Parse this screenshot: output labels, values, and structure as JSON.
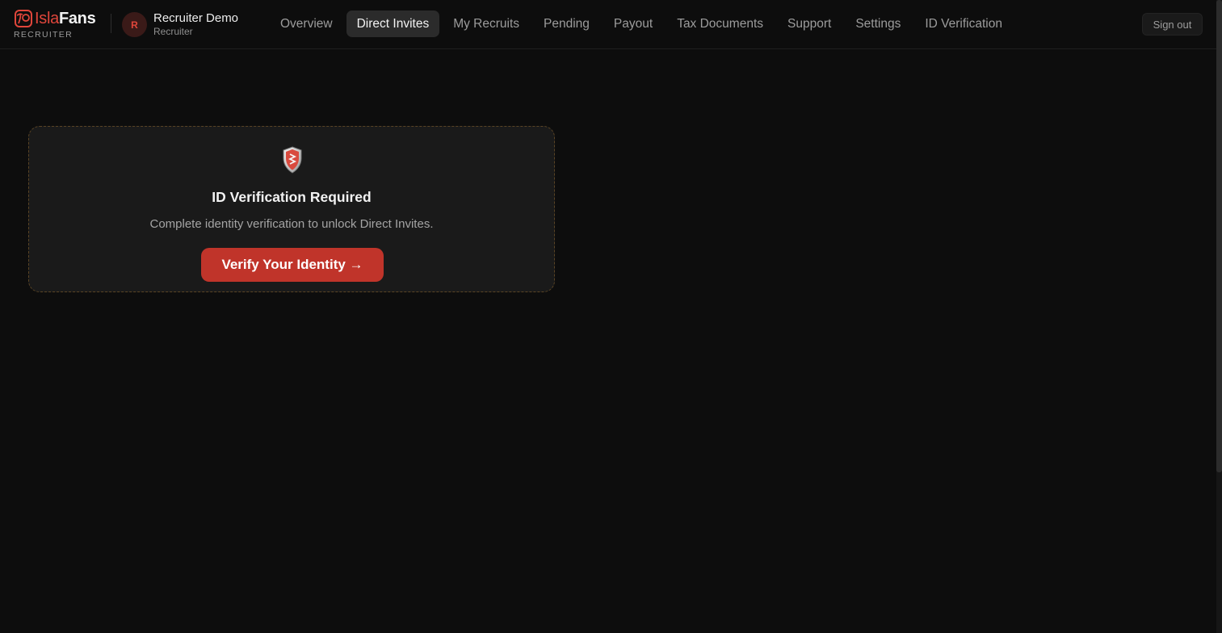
{
  "brand": {
    "name_part1": "Isla",
    "name_part2": "Fans",
    "subtitle": "RECRUITER",
    "logo_icon": "palm-sun-logo-icon",
    "accent_color": "#e0463b"
  },
  "user": {
    "avatar_initial": "R",
    "name": "Recruiter Demo",
    "role": "Recruiter"
  },
  "nav": {
    "items": [
      {
        "label": "Overview",
        "active": false
      },
      {
        "label": "Direct Invites",
        "active": true
      },
      {
        "label": "My Recruits",
        "active": false
      },
      {
        "label": "Pending",
        "active": false
      },
      {
        "label": "Payout",
        "active": false
      },
      {
        "label": "Tax Documents",
        "active": false
      },
      {
        "label": "Support",
        "active": false
      },
      {
        "label": "Settings",
        "active": false
      },
      {
        "label": "ID Verification",
        "active": false
      }
    ],
    "signout_label": "Sign out"
  },
  "verification_card": {
    "icon": "shield-icon",
    "title": "ID Verification Required",
    "description": "Complete identity verification to unlock Direct Invites.",
    "button_label": "Verify Your Identity →",
    "button_color": "#c0342a"
  }
}
